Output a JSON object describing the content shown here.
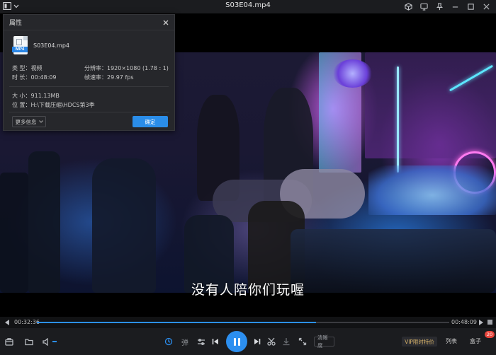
{
  "window": {
    "title": "S03E04.mp4"
  },
  "video": {
    "subtitle": "没有人陪你们玩喔"
  },
  "properties_dialog": {
    "title": "属性",
    "file_name": "S03E04.mp4",
    "file_badge": "MP4",
    "type": "类 型：视频",
    "duration": "时 长：00:48:09",
    "resolution": "分辨率：1920×1080 (1.78 : 1)",
    "frame_rate": "帧速率：29.97 fps",
    "size": "大 小：911.13MB",
    "location": "位 置：H:\\下载压缩\\HDCS第3季",
    "more_info_label": "更多信息",
    "ok_label": "确定"
  },
  "progress": {
    "current_time": "00:32:36",
    "total_time": "00:48:09",
    "fraction": 0.677
  },
  "controls": {
    "danmaku_label": "弹",
    "quality_label": "清晰度",
    "vip_label": "VIP限时特价",
    "playlist_label": "列表",
    "box_label": "盒子",
    "box_badge": "20"
  },
  "colors": {
    "accent": "#2c8ff0",
    "vip": "#d9b46a",
    "badge": "#e8453c"
  }
}
